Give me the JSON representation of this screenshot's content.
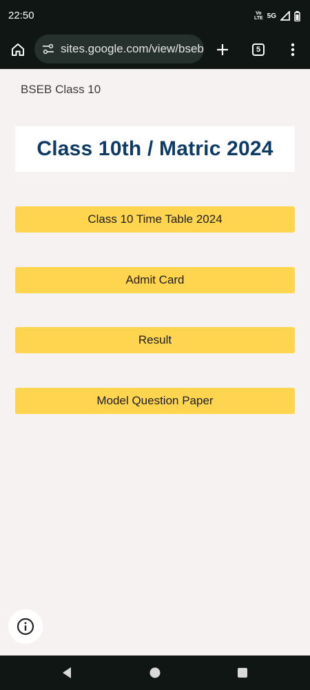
{
  "status_bar": {
    "time": "22:50",
    "volte_top": "Vo",
    "volte_bottom": "LTE",
    "network": "5G",
    "icons": [
      "volte-icon",
      "signal-icon",
      "battery-icon"
    ]
  },
  "browser": {
    "url": "sites.google.com/view/bseb",
    "tab_count": "5",
    "icons": [
      "home-icon",
      "site-settings-icon",
      "plus-icon",
      "menu-dots-icon"
    ]
  },
  "page": {
    "site_name": "BSEB Class 10",
    "hero_title": "Class 10th / Matric 2024",
    "buttons": [
      {
        "label": "Class 10 Time Table 2024"
      },
      {
        "label": "Admit Card"
      },
      {
        "label": "Result"
      },
      {
        "label": "Model Question Paper"
      }
    ],
    "info_icon": "info-icon"
  },
  "nav": {
    "icons": [
      "back-icon",
      "home-circle-icon",
      "recents-icon"
    ]
  },
  "colors": {
    "chrome_bg": "#0f1613",
    "page_bg": "#f6f2f2",
    "hero_text": "#0d3b66",
    "button_bg": "#ffd54f"
  }
}
